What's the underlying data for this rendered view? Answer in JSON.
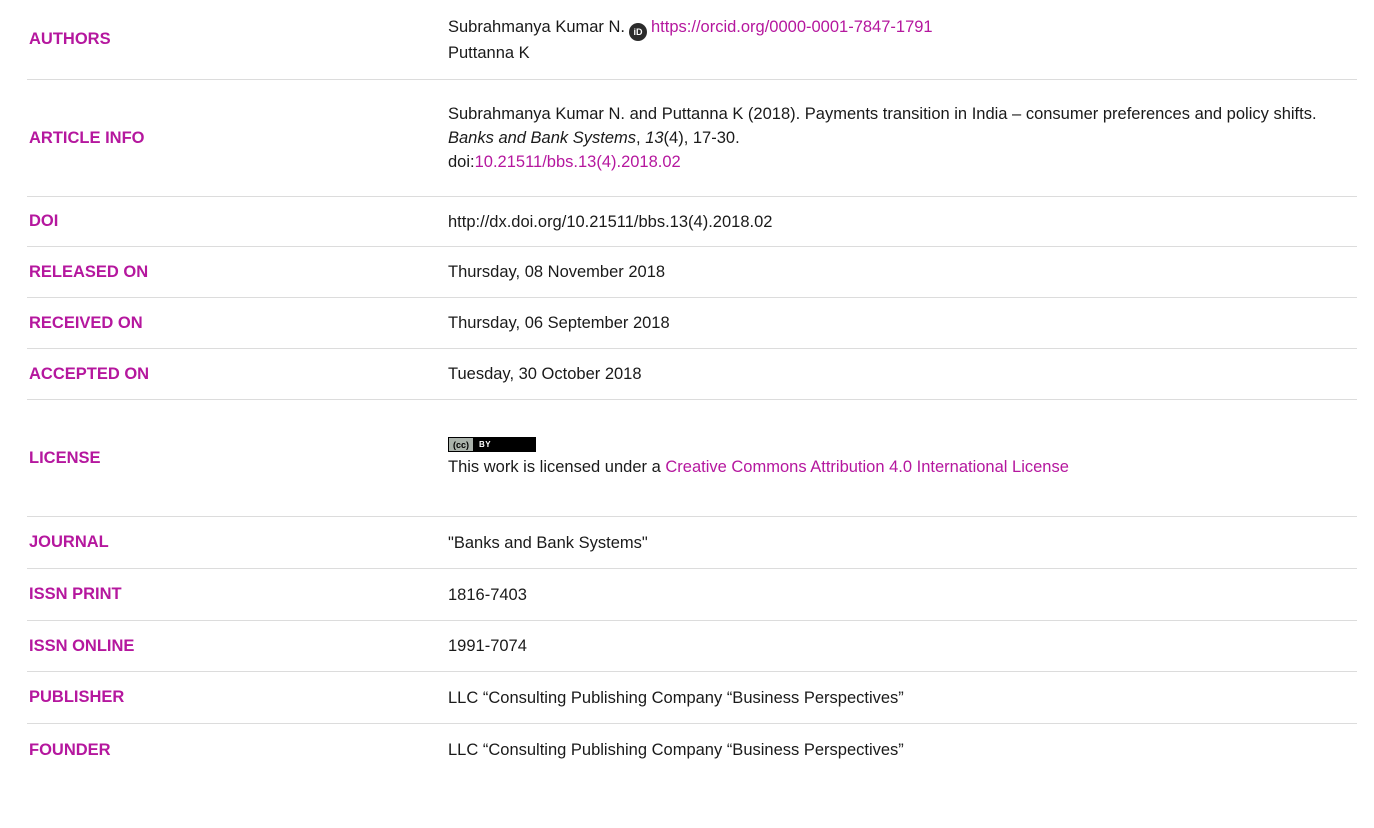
{
  "authors": {
    "label": "AUTHORS",
    "author1_name": "Subrahmanya Kumar N.",
    "author1_orcid_badge": "iD",
    "author1_orcid_url": "https://orcid.org/0000-0001-7847-1791",
    "author2_name": "Puttanna K"
  },
  "article_info": {
    "label": "ARTICLE INFO",
    "citation_part1": "Subrahmanya Kumar N. and Puttanna K (2018). Payments transition in India – consumer preferences and policy shifts. ",
    "journal_italic": "Banks and Bank Systems",
    "comma": ", ",
    "volume_italic": "13",
    "citation_part2": "(4), 17-30.",
    "doi_prefix": "doi:",
    "doi_link": "10.21511/bbs.13(4).2018.02"
  },
  "doi": {
    "label": "DOI",
    "value": "http://dx.doi.org/10.21511/bbs.13(4).2018.02"
  },
  "released_on": {
    "label": "RELEASED ON",
    "value": "Thursday, 08 November 2018"
  },
  "received_on": {
    "label": "RECEIVED ON",
    "value": "Thursday, 06 September 2018"
  },
  "accepted_on": {
    "label": "ACCEPTED ON",
    "value": "Tuesday, 30 October 2018"
  },
  "license": {
    "label": "LICENSE",
    "badge_cc": "(cc)",
    "badge_by": "BY",
    "text": "This work is licensed under a ",
    "link_text": "Creative Commons Attribution 4.0 International License"
  },
  "journal": {
    "label": "JOURNAL",
    "value": "\"Banks and Bank Systems\""
  },
  "issn_print": {
    "label": "ISSN PRINT",
    "value": "1816-7403"
  },
  "issn_online": {
    "label": "ISSN ONLINE",
    "value": "1991-7074"
  },
  "publisher": {
    "label": "PUBLISHER",
    "value": "LLC “Consulting Publishing Company “Business Perspectives”"
  },
  "founder": {
    "label": "FOUNDER",
    "value": "LLC “Consulting Publishing Company “Business Perspectives”"
  },
  "colors": {
    "label_accent": "#b5179e",
    "text": "#1a1a1a",
    "divider": "#dcdcdc"
  }
}
